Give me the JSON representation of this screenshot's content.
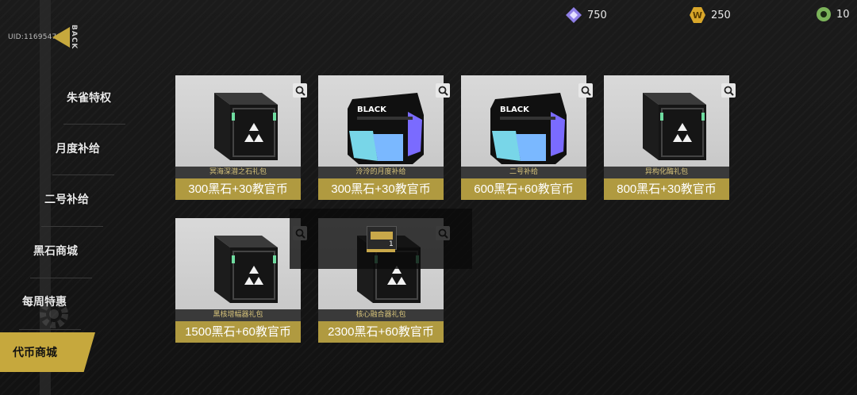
{
  "uid": "UID:11695479",
  "back_label": "BACK",
  "currencies": [
    {
      "icon": "purple-gem-icon",
      "value": "750",
      "color": "#8f7fe6"
    },
    {
      "icon": "gold-coin-icon",
      "value": "250",
      "color": "#d9a72a"
    },
    {
      "icon": "green-token-icon",
      "value": "10",
      "color": "#7bb35a"
    }
  ],
  "nav": [
    {
      "label": "朱雀特权",
      "active": false
    },
    {
      "label": "月度补给",
      "active": false
    },
    {
      "label": "二号补给",
      "active": false
    },
    {
      "label": "黑石商城",
      "active": false
    },
    {
      "label": "每周特惠",
      "active": false
    },
    {
      "label": "代币商城",
      "active": true
    }
  ],
  "items": [
    {
      "name": "冥海深潜之石礼包",
      "price": "300黑石+30教官币",
      "box": "cube"
    },
    {
      "name": "泠泠的月度补给",
      "price": "300黑石+30教官币",
      "box": "black"
    },
    {
      "name": "二号补给",
      "price": "600黑石+60教官币",
      "box": "black"
    },
    {
      "name": "异构化酶礼包",
      "price": "800黑石+30教官币",
      "box": "cube"
    },
    {
      "name": "黑核增幅器礼包",
      "price": "1500黑石+60教官币",
      "box": "cube"
    },
    {
      "name": "核心融合器礼包",
      "price": "2300黑石+60教官币",
      "box": "cube"
    }
  ],
  "popup": {
    "count": "1"
  },
  "colors": {
    "accent": "#c6a83d",
    "price_bg": "#b09a40",
    "name_text": "#d6c27a"
  }
}
